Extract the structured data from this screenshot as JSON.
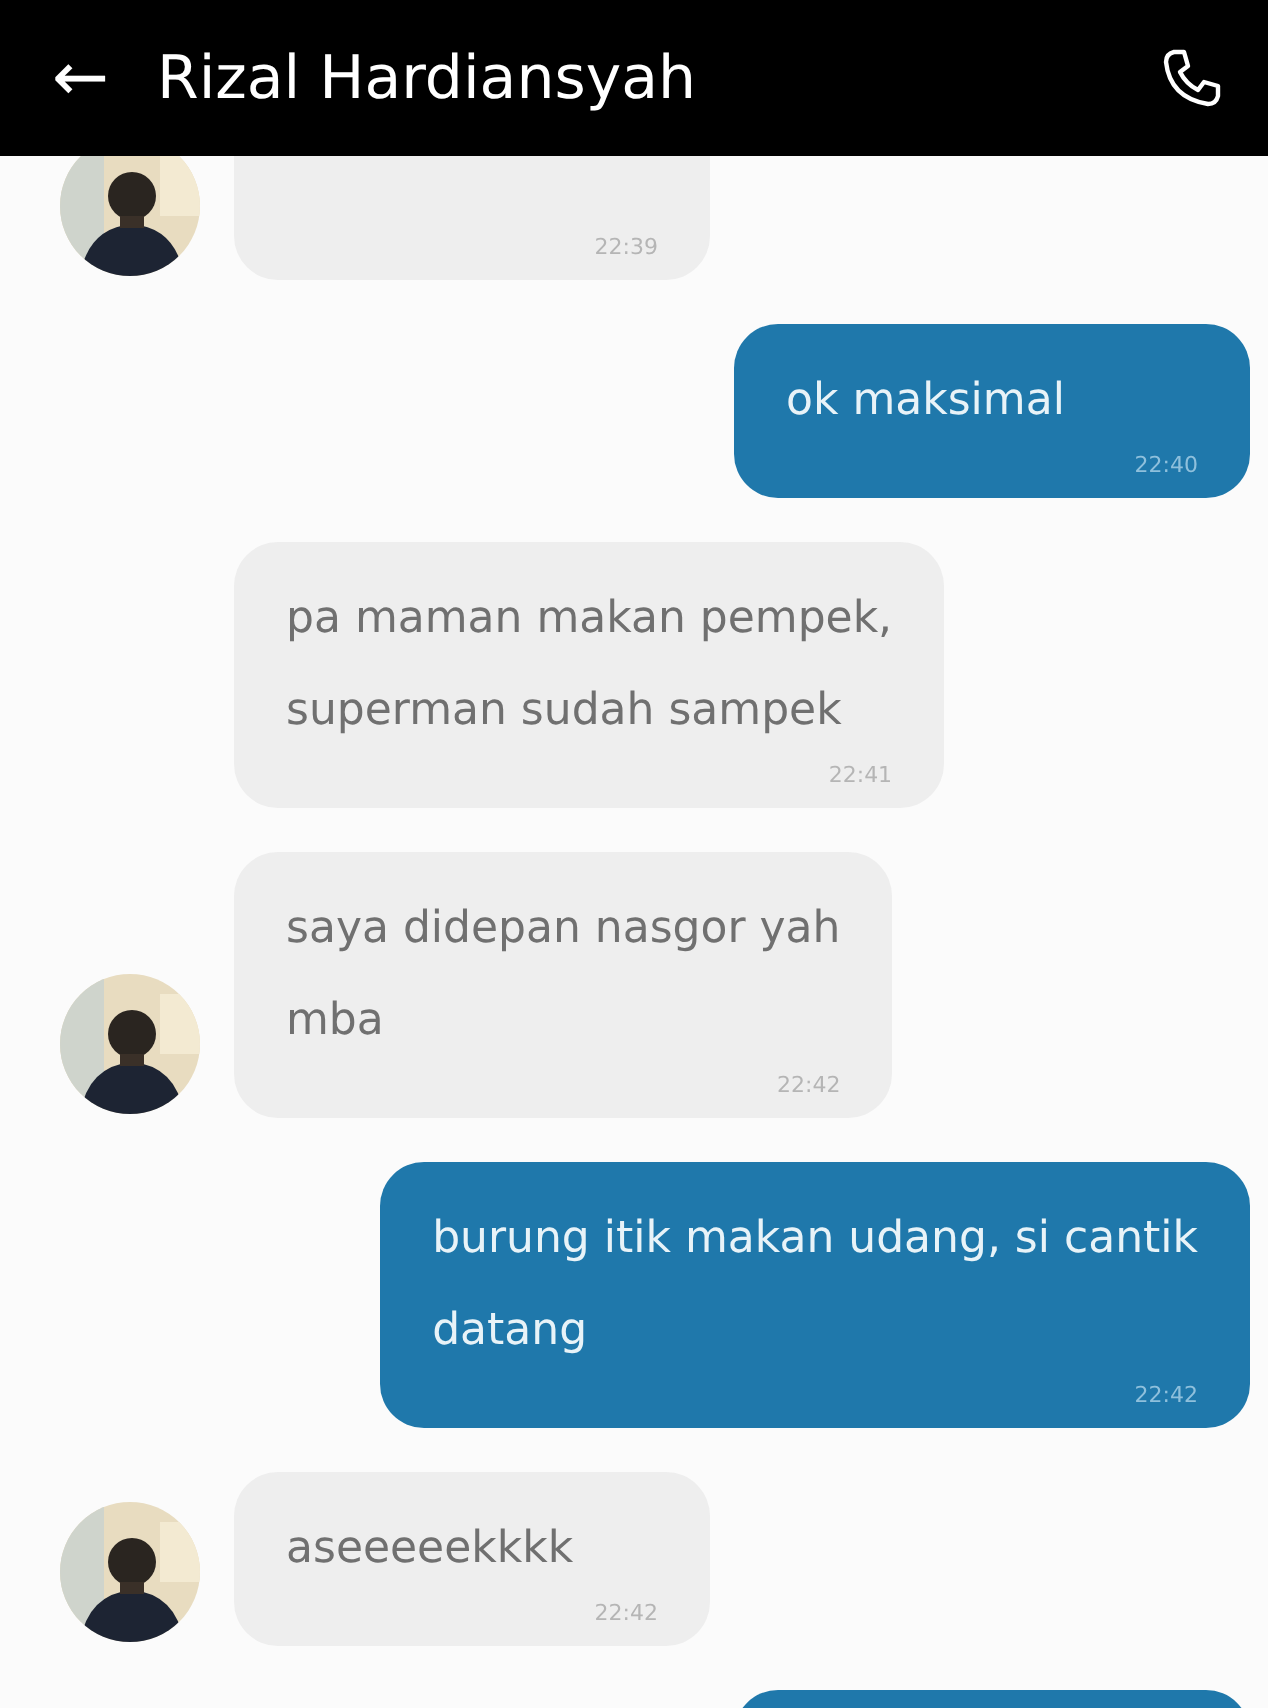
{
  "header": {
    "back": "←",
    "title": "Rizal Hardiansyah"
  },
  "messages": [
    {
      "kind": "received",
      "avatar": true,
      "time": "22:39"
    },
    {
      "kind": "sent",
      "lines": [
        "ok maksimal"
      ],
      "time": "22:40"
    },
    {
      "kind": "received",
      "avatar": false,
      "lines": [
        "pa maman makan pempek,",
        "superman sudah sampek"
      ],
      "time": "22:41"
    },
    {
      "kind": "received",
      "avatar": true,
      "lines": [
        "saya didepan nasgor yah",
        "mba"
      ],
      "time": "22:42"
    },
    {
      "kind": "sent",
      "lines": [
        "burung itik makan udang, si cantik",
        "datang"
      ],
      "time": "22:42"
    },
    {
      "kind": "received",
      "avatar": true,
      "lines": [
        "aseeeeekkkk"
      ],
      "time": "22:42"
    },
    {
      "kind": "sent"
    }
  ]
}
